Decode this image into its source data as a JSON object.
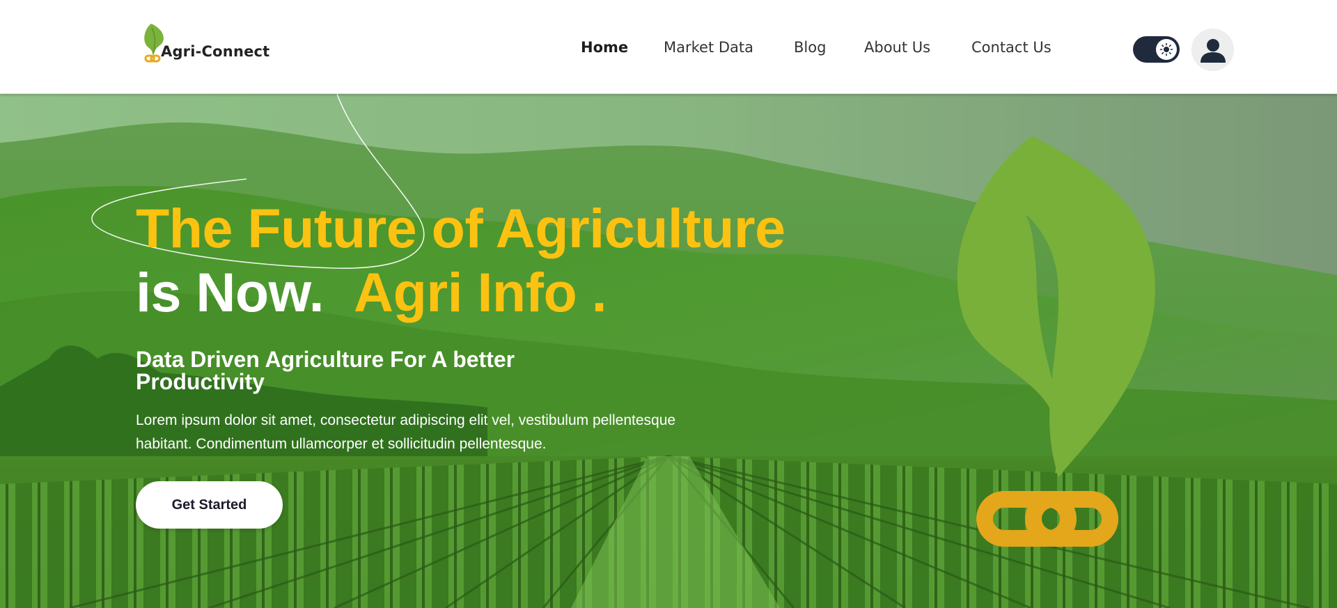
{
  "brand": {
    "name": "Agri-Connect",
    "leaf_color": "#7ab23a",
    "link_color": "#e9a91a"
  },
  "nav": {
    "items": [
      {
        "label": "Home",
        "active": true
      },
      {
        "label": "Market Data",
        "active": false
      },
      {
        "label": "Blog",
        "active": false
      },
      {
        "label": "About Us",
        "active": false
      },
      {
        "label": "Contact Us",
        "active": false
      }
    ]
  },
  "header": {
    "theme_toggle": {
      "state": "on",
      "icon": "sun-icon"
    },
    "profile": {
      "icon": "user-icon"
    }
  },
  "hero": {
    "headline_line1": "The Future of Agriculture",
    "headline_line2_white": "is Now.",
    "headline_line2_yellow": "Agri Info .",
    "subheading": "Data Driven Agriculture For A better Productivity",
    "description": "Lorem ipsum dolor sit amet, consectetur adipiscing elit vel, vestibulum pellentesque habitant. Condimentum ullamcorper et sollicitudin pellentesque.",
    "cta_label": "Get Started",
    "accent_color": "#fcc211"
  }
}
